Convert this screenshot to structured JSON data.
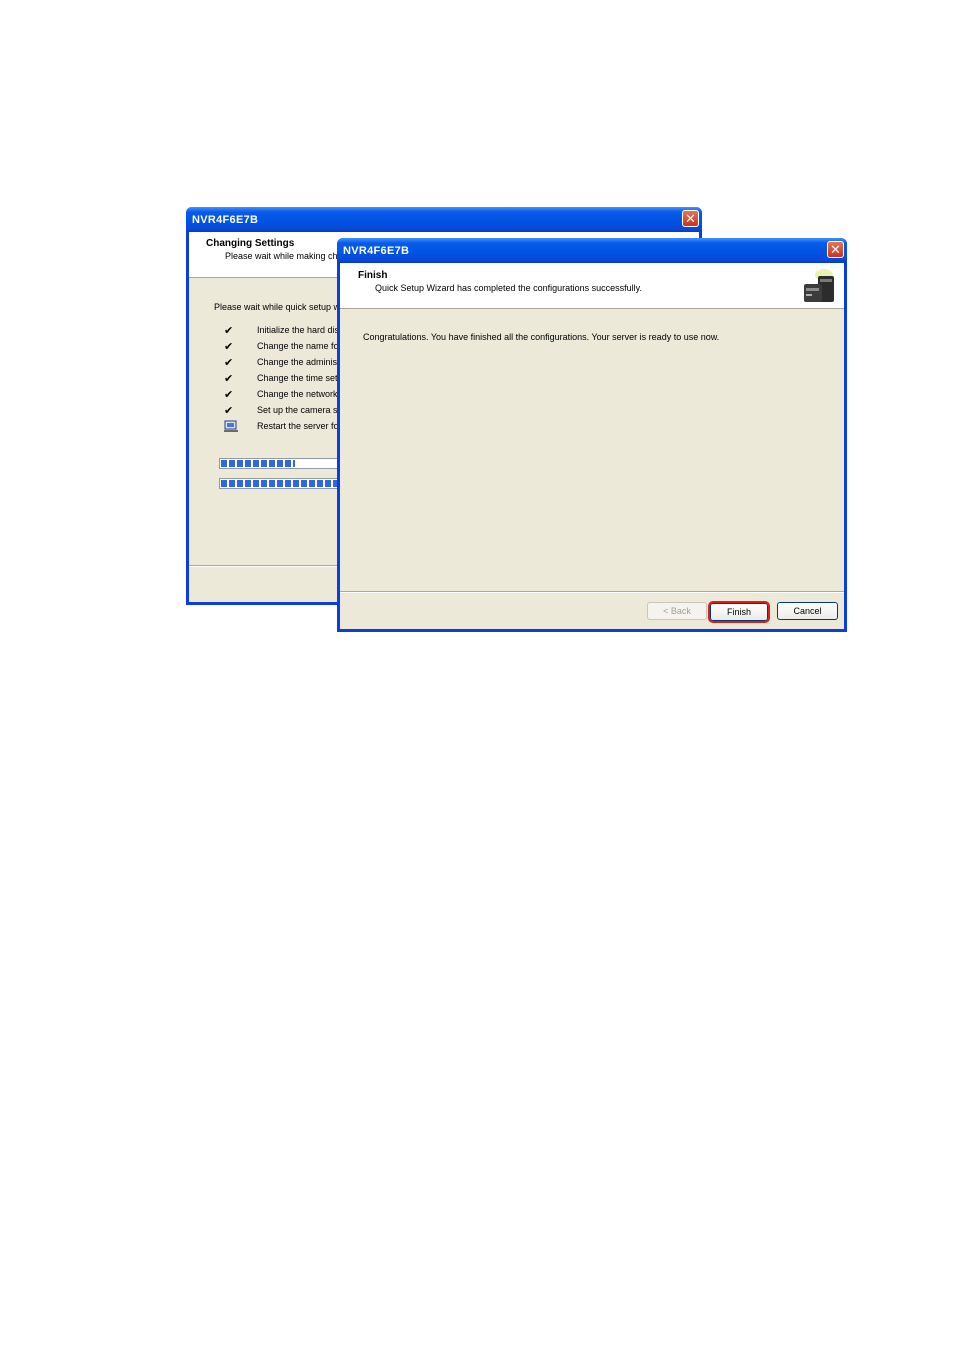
{
  "back_window": {
    "title": "NVR4F6E7B",
    "header_title": "Changing Settings",
    "header_subtitle": "Please wait while making cha",
    "intro": "Please wait while quick setup w",
    "steps": [
      {
        "label": "Initialize the hard disk",
        "icon": "check-icon",
        "glyph": "✔"
      },
      {
        "label": "Change the name fo",
        "icon": "check-icon",
        "glyph": "✔"
      },
      {
        "label": "Change the administ",
        "icon": "check-icon",
        "glyph": "✔"
      },
      {
        "label": "Change the time sett",
        "icon": "check-icon",
        "glyph": "✔"
      },
      {
        "label": "Change the network",
        "icon": "check-icon",
        "glyph": "✔"
      },
      {
        "label": "Set up the camera se",
        "icon": "check-icon",
        "glyph": "✔"
      },
      {
        "label": "Restart the server fo",
        "icon": "computer-arrow-icon",
        "glyph": ""
      }
    ],
    "progress_bars": [
      {
        "name": "step-progress",
        "fraction": 0.55
      },
      {
        "name": "overall-progress",
        "fraction": 0.98
      }
    ]
  },
  "front_window": {
    "title": "NVR4F6E7B",
    "header_title": "Finish",
    "header_subtitle": "Quick Setup Wizard has completed the configurations successfully.",
    "message": "Congratulations. You have finished all the configurations. Your server is ready to use now.",
    "icon": "nas-server-icon",
    "buttons": {
      "back": "< Back",
      "finish": "Finish",
      "cancel": "Cancel"
    }
  },
  "colors": {
    "titlebar": "#0054e3",
    "dialog_bg": "#ece9d8",
    "highlight": "#e01b1b"
  }
}
